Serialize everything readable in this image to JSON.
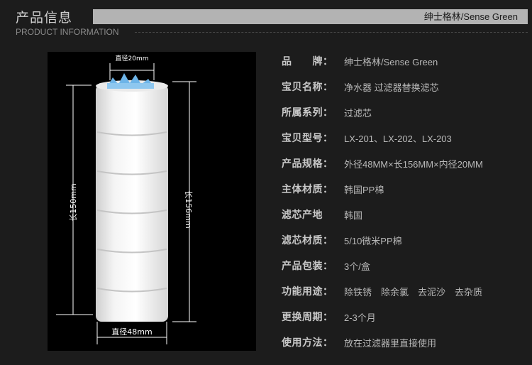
{
  "header": {
    "title": "产品信息",
    "subtitle": "PRODUCT INFORMATION",
    "brand": "绅士格林/Sense Green"
  },
  "photo": {
    "dim_top": "直径20mm",
    "dim_left": "长150mm",
    "dim_right": "长156mm",
    "dim_bottom": "直径48mm"
  },
  "specs": [
    {
      "label": "品　　牌：",
      "value": "绅士格林/Sense Green"
    },
    {
      "label": "宝贝名称：",
      "value": "净水器 过滤器替换滤芯"
    },
    {
      "label": "所属系列：",
      "value": "过滤芯"
    },
    {
      "label": "宝贝型号：",
      "value": "LX-201、LX-202、LX-203"
    },
    {
      "label": "产品规格：",
      "value": "外径48MM×长156MM×内径20MM"
    },
    {
      "label": "主体材质：",
      "value": "韩国PP棉"
    },
    {
      "label": "滤芯产地",
      "value": "韩国"
    },
    {
      "label": "滤芯材质：",
      "value": "5/10微米PP棉"
    },
    {
      "label": "产品包装：",
      "value": "3个/盒"
    },
    {
      "label": "功能用途：",
      "value": "除铁锈　除余氯　去泥沙　去杂质"
    },
    {
      "label": "更换周期：",
      "value": "2-3个月"
    },
    {
      "label": "使用方法：",
      "value": "放在过滤器里直接使用"
    }
  ],
  "colors": {
    "background": "#1c1c1c",
    "header_bar": "#b3b3b3",
    "cap_blue": "#6db4e8"
  }
}
